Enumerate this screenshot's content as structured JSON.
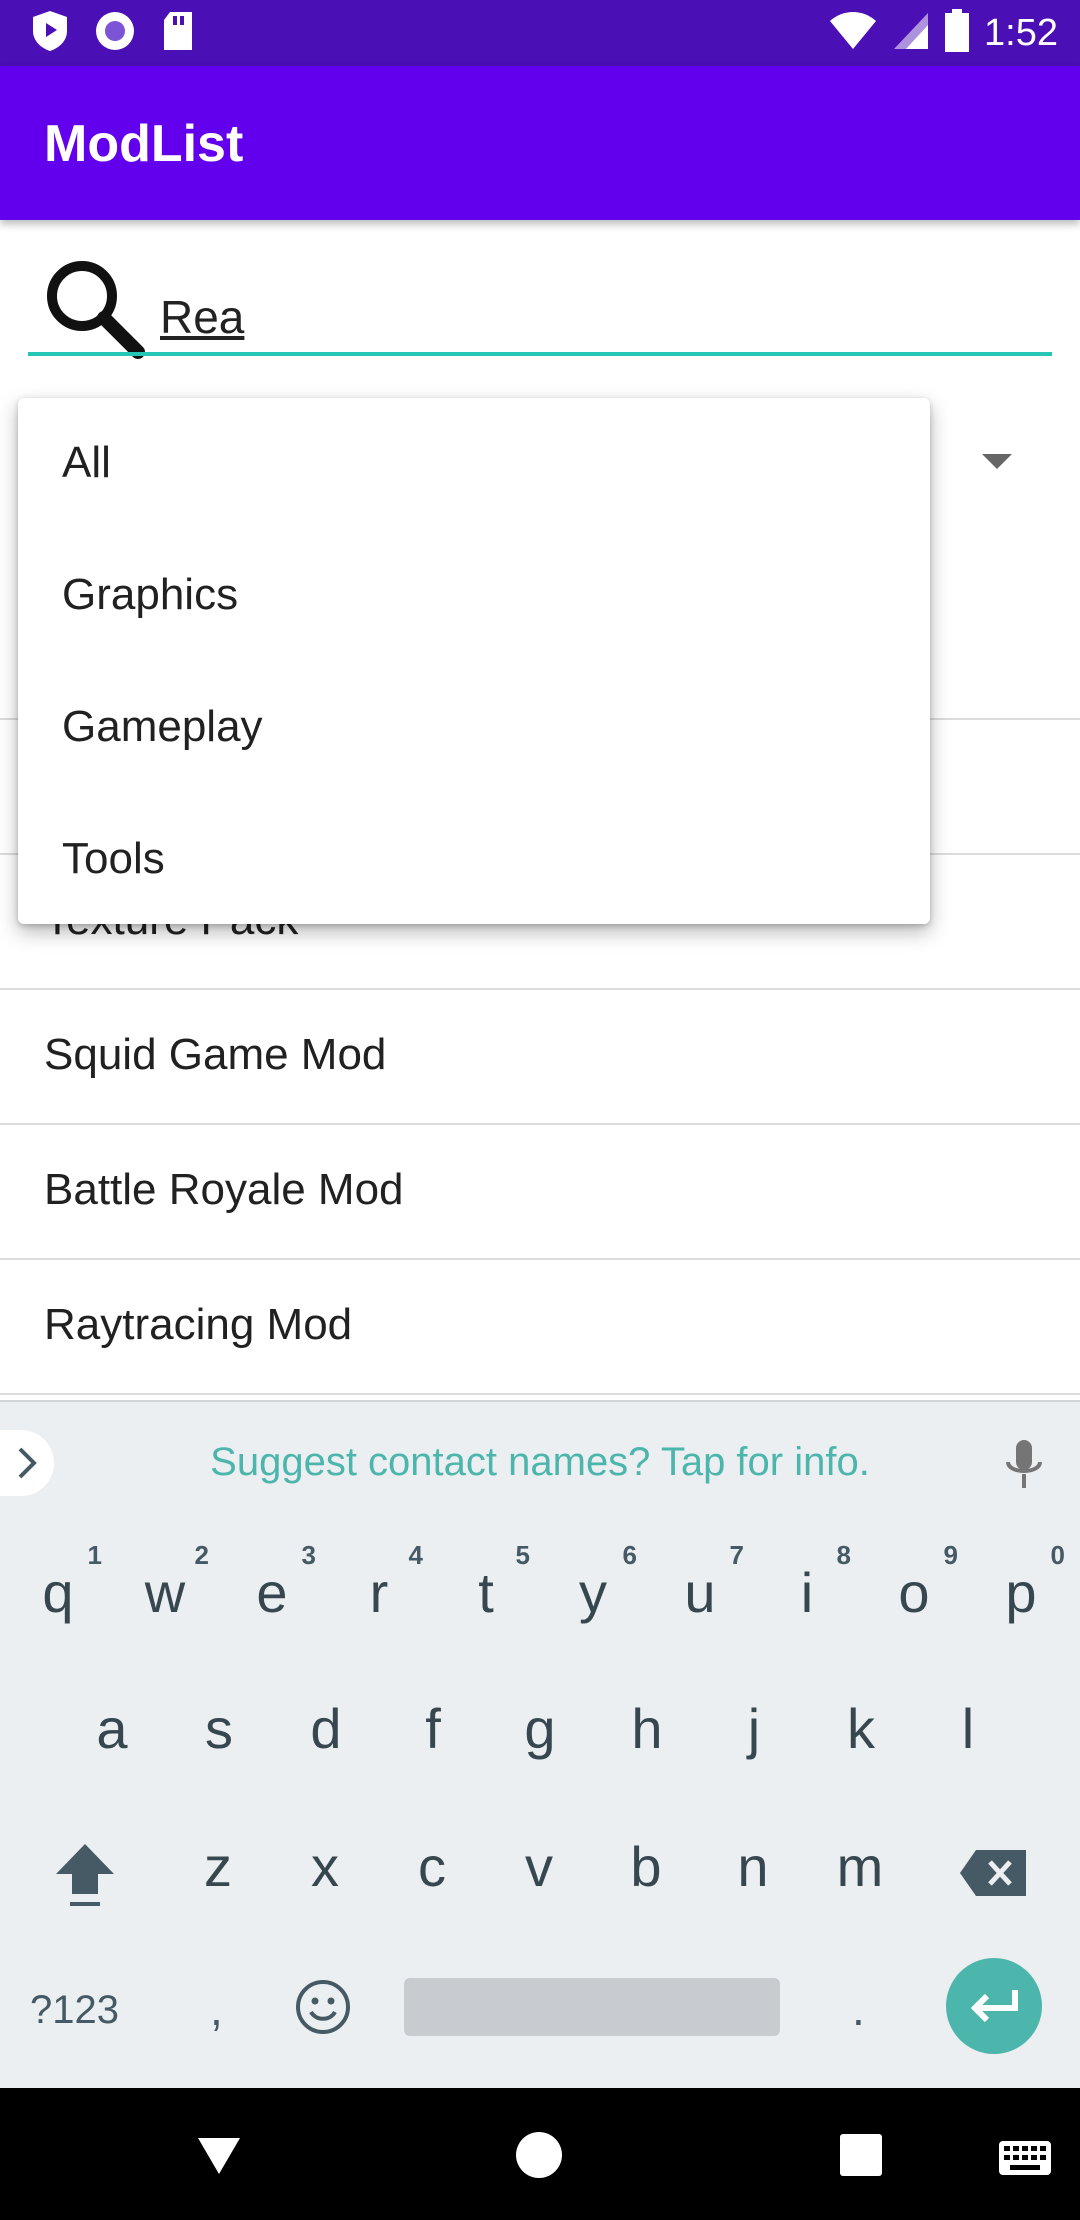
{
  "status_bar": {
    "time": "1:52",
    "icons": [
      "shield-icon",
      "circle-record-icon",
      "sd-card-icon",
      "wifi-icon",
      "signal-icon",
      "battery-icon"
    ]
  },
  "app_bar": {
    "title": "ModList"
  },
  "search": {
    "value": "Rea",
    "icon": "search-icon",
    "accent_color": "#26c6b6"
  },
  "dropdown": {
    "options": [
      "All",
      "Graphics",
      "Gameplay",
      "Tools"
    ]
  },
  "list": {
    "items": [
      "Texture Pack",
      "Squid Game Mod",
      "Battle Royale Mod",
      "Raytracing Mod"
    ]
  },
  "keyboard": {
    "suggestion": "Suggest contact names? Tap for info.",
    "row1": [
      {
        "key": "q",
        "hint": "1"
      },
      {
        "key": "w",
        "hint": "2"
      },
      {
        "key": "e",
        "hint": "3"
      },
      {
        "key": "r",
        "hint": "4"
      },
      {
        "key": "t",
        "hint": "5"
      },
      {
        "key": "y",
        "hint": "6"
      },
      {
        "key": "u",
        "hint": "7"
      },
      {
        "key": "i",
        "hint": "8"
      },
      {
        "key": "o",
        "hint": "9"
      },
      {
        "key": "p",
        "hint": "0"
      }
    ],
    "row2": [
      "a",
      "s",
      "d",
      "f",
      "g",
      "h",
      "j",
      "k",
      "l"
    ],
    "row3": [
      "z",
      "x",
      "c",
      "v",
      "b",
      "n",
      "m"
    ],
    "symbols_label": "?123",
    "comma": ",",
    "period": "."
  },
  "colors": {
    "status_bar": "#4a0fb5",
    "app_bar": "#6200ee",
    "keyboard_accent": "#4db6ac"
  }
}
